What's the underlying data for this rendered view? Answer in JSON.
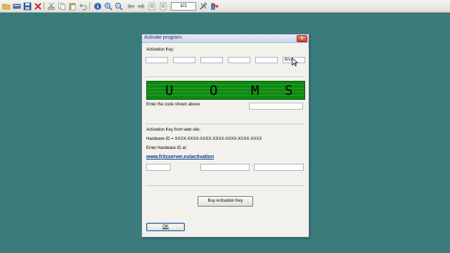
{
  "toolbar": {
    "page_indicator": "1/1",
    "icons": [
      "open-folder-icon",
      "scan-icon",
      "save-icon",
      "delete-icon",
      "cut-icon",
      "copy-icon",
      "paste-icon",
      "undo-icon",
      "info-icon",
      "zoom-in-icon",
      "zoom-out-icon",
      "back-arrow-icon",
      "forward-arrow-icon",
      "first-page-icon",
      "last-page-icon",
      "tools-icon",
      "exit-icon"
    ]
  },
  "dialog": {
    "title": "Activate program:",
    "close_label": "x",
    "activation_key_label": "Activation Key:",
    "key_fields": [
      "",
      "",
      "",
      "",
      "",
      "RY4"
    ],
    "captcha_chars": [
      "U",
      "O",
      "M",
      "S"
    ],
    "code_prompt": "Enter the code shown above:",
    "code_value": "",
    "web_section_label": "Activation Key from web site:",
    "hardware_id_label": "Hardware ID = XXXX-XXXX-XXXX-XXXX-XXXX-XXXX-XXXX",
    "enter_hardware_label": "Enter Hardware ID at:",
    "url": "www.fritzserver.eu/activation",
    "web_key_fields": [
      "",
      "",
      ""
    ],
    "buy_button": "Buy Activation Key",
    "ok_button": "OK"
  },
  "colors": {
    "desktop": "#3a7b7b",
    "captcha_bg": "#0f8a12",
    "link": "#0b3d91"
  }
}
